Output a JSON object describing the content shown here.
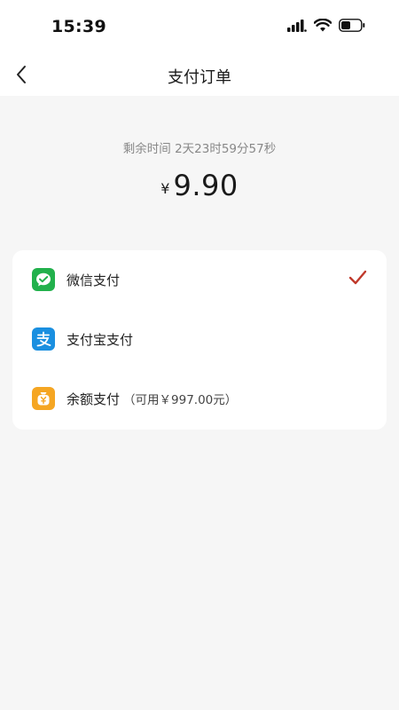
{
  "status_bar": {
    "time": "15:39"
  },
  "header": {
    "title": "支付订单"
  },
  "order": {
    "countdown_text": "剩余时间 2天23时59分57秒",
    "currency_symbol": "¥",
    "amount": "9.90"
  },
  "payment_methods": [
    {
      "label": "微信支付",
      "note": "",
      "icon": "wechat-pay-icon",
      "color": "#1aad19",
      "selected": true
    },
    {
      "label": "支付宝支付",
      "note": "",
      "icon": "alipay-icon",
      "color": "#1677ff",
      "selected": false
    },
    {
      "label": "余额支付",
      "note": "（可用￥997.00元）",
      "icon": "wallet-balance-icon",
      "color": "#f5a623",
      "selected": false
    }
  ],
  "colors": {
    "check_mark": "#c0392b",
    "background": "#f6f6f6"
  }
}
